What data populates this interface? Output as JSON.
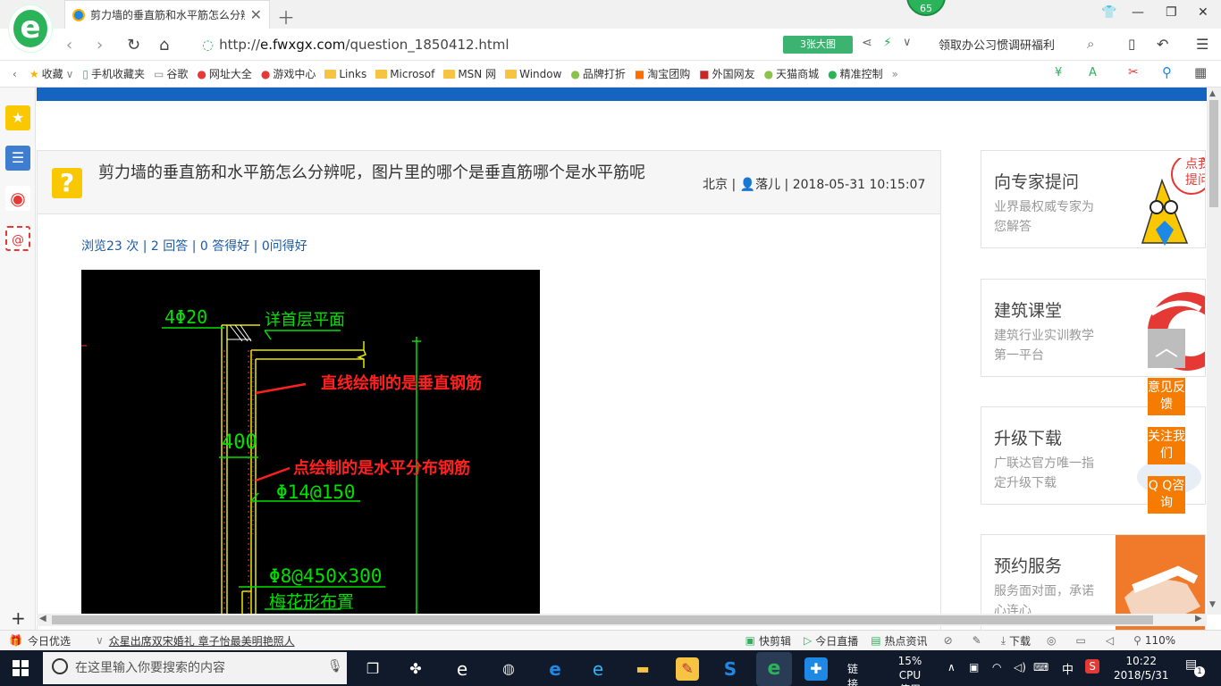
{
  "browser": {
    "tab_title": "剪力墙的垂直筋和水平筋怎么分辨",
    "badge_count": "65",
    "url_scheme": "http://",
    "url_host": "e.fwxgx.com",
    "url_path": "/question_1850412.html",
    "big_image_label": "3张大图",
    "promo_text": "领取办公习惯调研福利",
    "bookmarks": [
      "收藏",
      "手机收藏夹",
      "谷歌",
      "网址大全",
      "游戏中心",
      "Links",
      "Microsof",
      "MSN 网",
      "Window",
      "品牌打折",
      "淘宝团购",
      "外国网友",
      "天猫商城",
      "精准控制"
    ]
  },
  "question": {
    "title": "剪力墙的垂直筋和水平筋怎么分辨呢，图片里的哪个是垂直筋哪个是水平筋呢",
    "location": "北京",
    "user": "落儿",
    "datetime": "2018-05-31 10:15:07",
    "stats": "浏览23 次 | 2 回答 | 0 答得好 | 0问得好"
  },
  "cad": {
    "label_4phi20": "4Φ20",
    "label_floor": "详首层平面",
    "annot_vertical": "直线绘制的是垂直钢筋",
    "label_400": "400",
    "annot_horizontal": "点绘制的是水平分布钢筋",
    "label_phi14": "Φ14@150",
    "label_phi8": "Φ8@450x300",
    "label_plum": "梅花形布置"
  },
  "sidebar_cards": [
    {
      "title": "向专家提问",
      "sub": "业界最权威专家为您解答",
      "bubble": "点我提问"
    },
    {
      "title": "建筑课堂",
      "sub": "建筑行业实训教学第一平台"
    },
    {
      "title": "升级下载",
      "sub": "广联达官方唯一指定升级下载"
    },
    {
      "title": "预约服务",
      "sub": "服务面对面，承诺心连心"
    }
  ],
  "float_buttons": [
    "意见反馈",
    "关注我们",
    "Q Q咨询"
  ],
  "statusbar": {
    "today": "今日优选",
    "news": "众星出席双宋婚礼 章子怡最美明艳照人",
    "quickclip": "快剪辑",
    "live": "今日直播",
    "hotnews": "热点资讯",
    "download": "下载",
    "zoom": "110%"
  },
  "taskbar": {
    "search_placeholder": "在这里输入你要搜索的内容",
    "link_label": "链接",
    "cpu_percent": "15%",
    "cpu_label": "CPU使用",
    "ime": "中",
    "time": "10:22",
    "date": "2018/5/31",
    "notif": "1"
  },
  "colors": {
    "accent_blue": "#1565c0",
    "brand_green": "#2bb35a",
    "orange": "#f57c00"
  }
}
